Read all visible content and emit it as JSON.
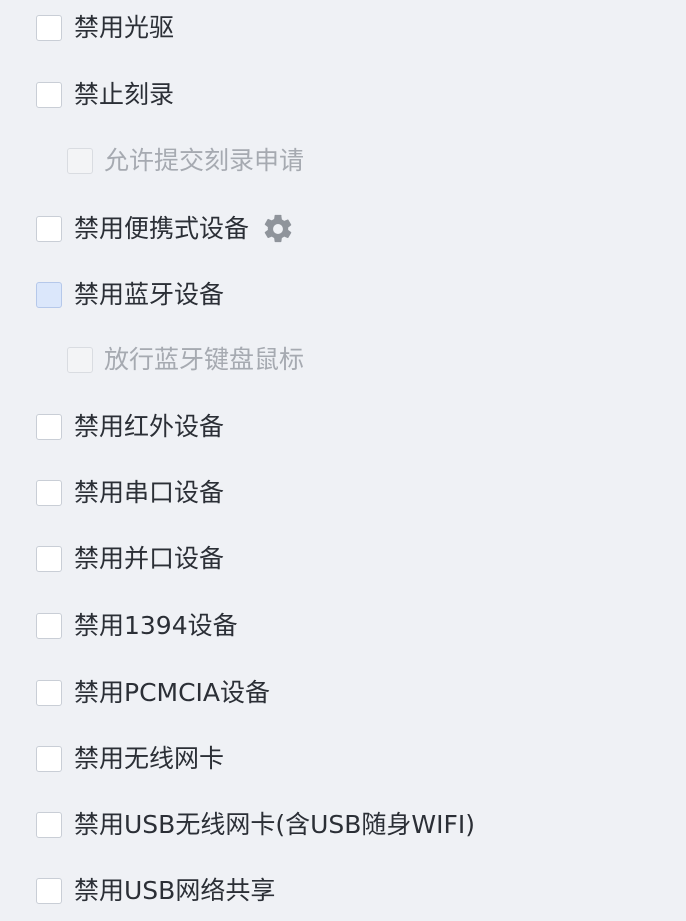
{
  "options": {
    "disable_optical_drive": {
      "label": "禁用光驱",
      "checked": false
    },
    "disable_burning": {
      "label": "禁止刻录",
      "checked": false
    },
    "allow_burn_request": {
      "label": "允许提交刻录申请",
      "checked": false,
      "disabled": true
    },
    "disable_portable_devices": {
      "label": "禁用便携式设备",
      "checked": false,
      "settings_icon": "gear-icon"
    },
    "disable_bluetooth": {
      "label": "禁用蓝牙设备",
      "checked": false,
      "hovered": true
    },
    "allow_bt_keyboard_mouse": {
      "label": "放行蓝牙键盘鼠标",
      "checked": false,
      "disabled": true
    },
    "disable_infrared": {
      "label": "禁用红外设备",
      "checked": false
    },
    "disable_serial": {
      "label": "禁用串口设备",
      "checked": false
    },
    "disable_parallel": {
      "label": "禁用并口设备",
      "checked": false
    },
    "disable_1394": {
      "label": "禁用1394设备",
      "checked": false
    },
    "disable_pcmcia": {
      "label": "禁用PCMCIA设备",
      "checked": false
    },
    "disable_wireless_nic": {
      "label": "禁用无线网卡",
      "checked": false
    },
    "disable_usb_wireless_nic": {
      "label": "禁用USB无线网卡(含USB随身WIFI)",
      "checked": false
    },
    "disable_usb_network_sharing": {
      "label": "禁用USB网络共享",
      "checked": false
    }
  },
  "colors": {
    "background": "#eff1f5",
    "text": "#2b2f36",
    "disabled_text": "#a6aab1",
    "checkbox_border": "#c9ced6",
    "checkbox_hover_fill": "#dbe7fb"
  }
}
